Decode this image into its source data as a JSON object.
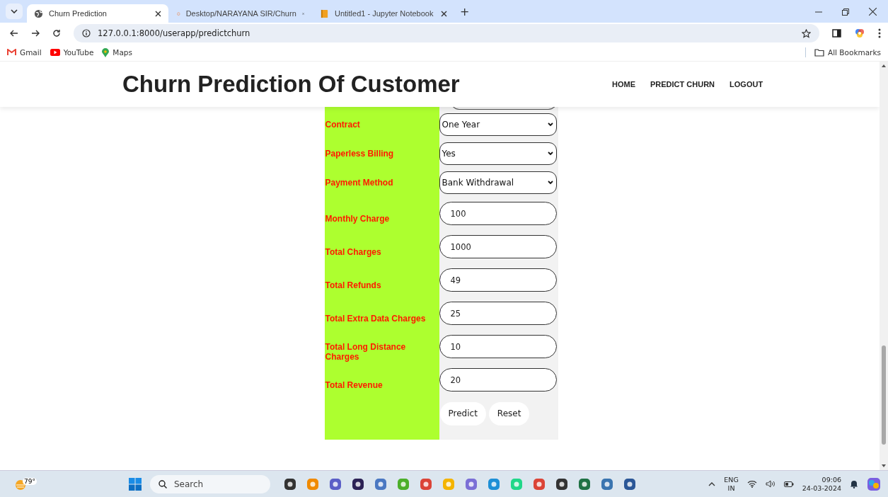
{
  "browser": {
    "tabs": [
      {
        "title": "Churn Prediction",
        "kind": "globe",
        "selected": true
      },
      {
        "title": "Desktop/NARAYANA SIR/Churn",
        "kind": "spinner",
        "selected": false
      },
      {
        "title": "Untitled1 - Jupyter Notebook",
        "kind": "notebook",
        "selected": false
      }
    ],
    "new_tab": "+",
    "url": "127.0.0.1:8000/userapp/predictchurn",
    "bookmarks": [
      {
        "label": "Gmail",
        "kind": "gmail"
      },
      {
        "label": "YouTube",
        "kind": "youtube"
      },
      {
        "label": "Maps",
        "kind": "maps"
      }
    ],
    "all_bookmarks": "All Bookmarks"
  },
  "page": {
    "title": "Churn Prediction Of Customer",
    "nav": [
      "HOME",
      "PREDICT CHURN",
      "LOGOUT"
    ],
    "form": [
      {
        "kind": "select",
        "label": "Contract",
        "value": "One Year"
      },
      {
        "kind": "select",
        "label": "Paperless Billing",
        "value": "Yes"
      },
      {
        "kind": "select",
        "label": "Payment Method",
        "value": "Bank Withdrawal"
      },
      {
        "kind": "input",
        "label": "Monthly Charge",
        "value": "100"
      },
      {
        "kind": "input",
        "label": "Total Charges",
        "value": "1000"
      },
      {
        "kind": "input",
        "label": "Total Refunds",
        "value": "49"
      },
      {
        "kind": "input",
        "label": "Total Extra Data Charges",
        "value": "25"
      },
      {
        "kind": "input",
        "label": "Total Long Distance Charges",
        "value": "10"
      },
      {
        "kind": "input",
        "label": "Total Revenue",
        "value": "20"
      }
    ],
    "buttons": [
      "Predict",
      "Reset"
    ]
  },
  "taskbar": {
    "weather": "79°",
    "search_placeholder": "Search",
    "language": "ENG",
    "region": "IN",
    "time": "09:06",
    "date": "24-03-2024"
  }
}
